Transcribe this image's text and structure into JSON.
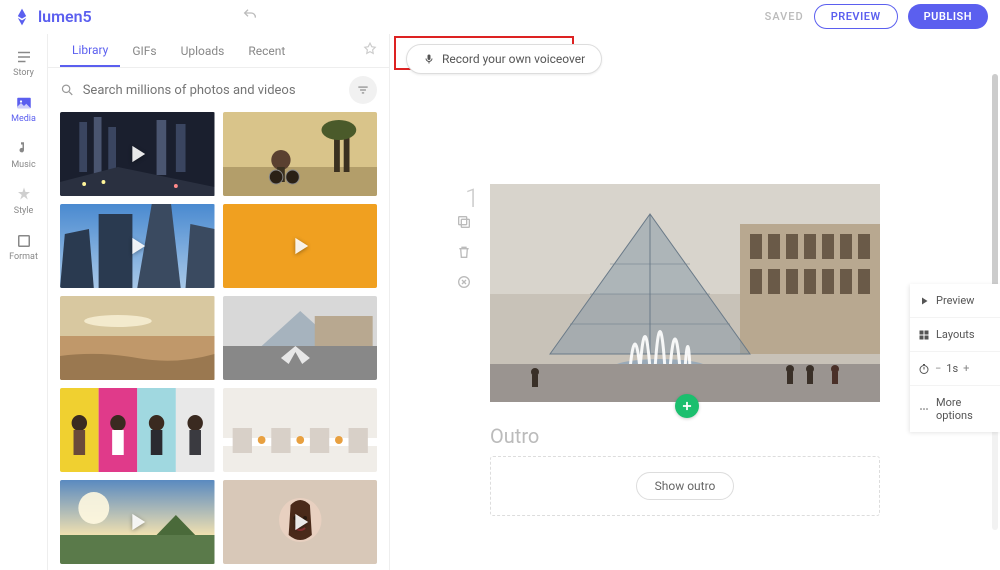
{
  "brand": "lumen5",
  "header": {
    "saved": "SAVED",
    "preview": "PREVIEW",
    "publish": "PUBLISH"
  },
  "nav": {
    "story": "Story",
    "media": "Media",
    "music": "Music",
    "style": "Style",
    "format": "Format"
  },
  "tabs": {
    "library": "Library",
    "gifs": "GIFs",
    "uploads": "Uploads",
    "recent": "Recent"
  },
  "search": {
    "placeholder": "Search millions of photos and videos"
  },
  "voiceover": {
    "label": "Record your own voiceover"
  },
  "scene": {
    "number": "1"
  },
  "contextPanel": {
    "preview": "Preview",
    "layouts": "Layouts",
    "duration": "1s",
    "durationMinus": "−",
    "durationPlus": "+",
    "more": "More options"
  },
  "outro": {
    "title": "Outro",
    "button": "Show outro"
  }
}
